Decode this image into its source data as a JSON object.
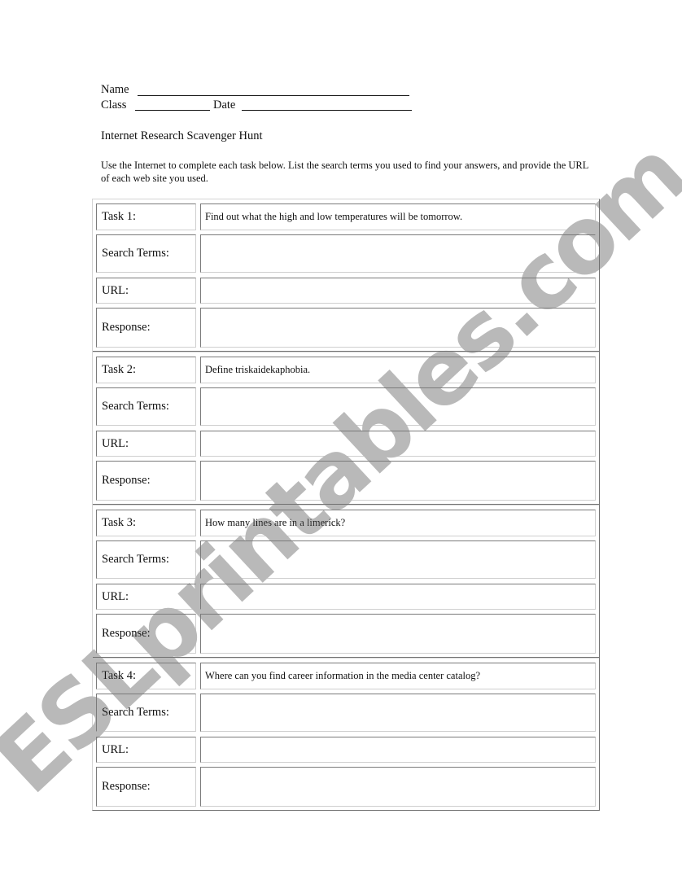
{
  "header": {
    "name_label": "Name",
    "class_label": "Class",
    "date_label": "Date"
  },
  "title": "Internet Research Scavenger Hunt",
  "instructions": "Use the Internet to complete each task below. List the search terms you used to find your answers, and provide the URL of each web site you used.",
  "row_labels": {
    "search": "Search Terms:",
    "url": "URL:",
    "response": "Response:"
  },
  "tasks": [
    {
      "label": "Task 1:",
      "prompt": "Find out what the high and low temperatures will be tomorrow.",
      "search_terms": "",
      "url": "",
      "response": ""
    },
    {
      "label": "Task 2:",
      "prompt": "Define triskaidekaphobia.",
      "search_terms": "",
      "url": "",
      "response": ""
    },
    {
      "label": "Task 3:",
      "prompt": "How many lines are in a limerick?",
      "search_terms": "",
      "url": "",
      "response": ""
    },
    {
      "label": "Task 4:",
      "prompt": "Where can you find career information in the media center catalog?",
      "search_terms": "",
      "url": "",
      "response": ""
    }
  ],
  "watermark": {
    "text": "ESLprintables.com",
    "color": "#b9b9b9"
  }
}
